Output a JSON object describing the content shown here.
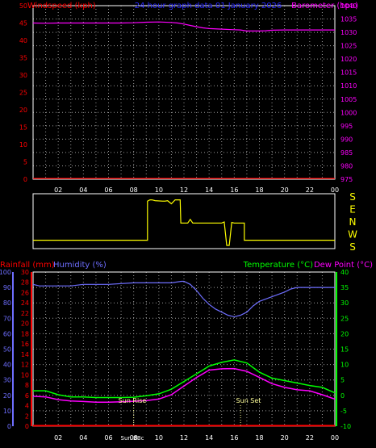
{
  "colors": {
    "background": "#000000",
    "frame": "#ffffff",
    "grid": "#9a9a9a",
    "windspeed": "#ff0000",
    "barometer": "#ff00ff",
    "title": "#2a2aff",
    "wind_dir": "#ffff00",
    "rainfall": "#ff0000",
    "humidity": "#6e6eff",
    "temperature": "#00ff00",
    "dewpoint": "#ff00ff",
    "sun": "#ffff99",
    "day_tick": "#ffffff"
  },
  "chart_data": [
    {
      "type": "line",
      "title": "24 hour graph data  01 January 2026",
      "x_ticks": [
        "02",
        "04",
        "06",
        "08",
        "10",
        "12",
        "14",
        "16",
        "18",
        "20",
        "22",
        "00"
      ],
      "y_left": {
        "label": "Windspeed (kph)",
        "range": [
          0,
          50
        ],
        "ticks": [
          "0",
          "5",
          "10",
          "15",
          "20",
          "25",
          "30",
          "35",
          "40",
          "45",
          "50"
        ]
      },
      "y_right": {
        "label": "Barometer (hpa)",
        "range": [
          975,
          1040
        ],
        "ticks": [
          "975",
          "980",
          "985",
          "990",
          "995",
          "1000",
          "1005",
          "1010",
          "1015",
          "1020",
          "1025",
          "1030",
          "1035",
          "1040"
        ]
      },
      "grid": true,
      "series": [
        {
          "name": "Windspeed (kph)",
          "axis": "left",
          "x": [
            0,
            24
          ],
          "y": [
            0.2,
            0.2
          ]
        },
        {
          "name": "Barometer (hpa)",
          "axis": "right",
          "x": [
            0,
            1,
            2,
            3,
            4,
            5,
            6,
            7,
            8,
            9,
            10,
            11,
            11.5,
            12,
            12.5,
            13,
            13.5,
            14,
            15,
            16,
            16.5,
            17,
            17.5,
            18,
            18.5,
            19,
            20,
            21,
            22,
            23,
            24
          ],
          "y": [
            1033.5,
            1033.4,
            1033.5,
            1033.5,
            1033.5,
            1033.5,
            1033.5,
            1033.5,
            1033.6,
            1033.8,
            1033.9,
            1033.7,
            1033.5,
            1033.1,
            1032.6,
            1032.1,
            1031.7,
            1031.4,
            1031.2,
            1031.0,
            1030.9,
            1030.5,
            1030.5,
            1030.5,
            1030.6,
            1030.8,
            1030.9,
            1030.9,
            1030.9,
            1030.9,
            1030.9
          ]
        }
      ]
    },
    {
      "type": "line",
      "y_labels": [
        "S",
        "E",
        "N",
        "W",
        "S"
      ],
      "series": [
        {
          "name": "Wind direction",
          "x": [
            0,
            9.1,
            9.1,
            9.3,
            9.45,
            9.7,
            10.3,
            10.5,
            10.7,
            11,
            11.3,
            11.7,
            11.75,
            12.3,
            12.5,
            12.7,
            13,
            15,
            15.2,
            15.4,
            15.6,
            15.8,
            16,
            16.5,
            16.8,
            16.8,
            18,
            24
          ],
          "y": [
            200,
            200,
            10,
            355,
            355,
            352,
            350,
            350,
            352,
            340,
            355,
            355,
            94,
            94,
            80,
            94,
            94,
            94,
            90,
            180,
            180,
            92,
            94,
            94,
            94,
            200,
            200,
            200
          ]
        }
      ]
    },
    {
      "type": "line",
      "x_ticks": [
        "02",
        "04",
        "06",
        "08",
        "10",
        "12",
        "14",
        "16",
        "18",
        "20",
        "22",
        "00"
      ],
      "y_left_outer": {
        "label": "Humidity (%)",
        "range": [
          0,
          100
        ],
        "ticks": [
          "0",
          "10",
          "20",
          "30",
          "40",
          "50",
          "60",
          "70",
          "80",
          "90",
          "100"
        ]
      },
      "y_left_inner": {
        "label": "Rainfall (mm)",
        "range": [
          0,
          30
        ],
        "ticks": [
          "0",
          "2",
          "4",
          "6",
          "8",
          "10",
          "12",
          "14",
          "16",
          "18",
          "20",
          "22",
          "24",
          "26",
          "28",
          "30"
        ]
      },
      "y_right": {
        "label_temp": "Temperature (°C)",
        "label_dew": "Dew Point (°C)",
        "range": [
          -10,
          40
        ],
        "ticks": [
          "-10",
          "-5",
          "0",
          "5",
          "10",
          "15",
          "20",
          "25",
          "30",
          "35",
          "40"
        ]
      },
      "annotations": {
        "sun_rise": "Sun Rise",
        "sun_set": "Sun Set",
        "sun_rise_hour": 8,
        "sun_set_hour": 16.5,
        "sun_bbc": "Sun BBc"
      },
      "grid": true,
      "series": [
        {
          "name": "Rainfall (mm)",
          "axis": "rain",
          "x": [
            0,
            24
          ],
          "y": [
            0.1,
            0.1
          ]
        },
        {
          "name": "Humidity (%)",
          "axis": "humidity",
          "x": [
            0,
            0.5,
            2,
            3,
            4,
            6,
            8,
            10,
            11,
            11.8,
            12,
            12.5,
            13,
            13.5,
            14,
            14.5,
            15,
            15.5,
            16,
            16.5,
            17,
            17.5,
            18,
            19,
            20,
            20.5,
            21,
            22,
            23,
            24
          ],
          "y": [
            92,
            91,
            91,
            91,
            92,
            92,
            93,
            93,
            93,
            94,
            94,
            92,
            88,
            83,
            79,
            76,
            74,
            72,
            71,
            72,
            74,
            78,
            81,
            84,
            87,
            89,
            90,
            90,
            90,
            90
          ]
        },
        {
          "name": "Temperature (°C)",
          "axis": "temp",
          "x": [
            0,
            1,
            2,
            3,
            4,
            5,
            6,
            7,
            8,
            9,
            10,
            11,
            12,
            13,
            14,
            15,
            16,
            17,
            18,
            19,
            20,
            21,
            22,
            23,
            24
          ],
          "y": [
            1.5,
            1.5,
            0.2,
            -0.5,
            -0.5,
            -0.7,
            -0.7,
            -0.7,
            -0.6,
            -0.1,
            0.5,
            2.0,
            4.5,
            7.0,
            9.5,
            10.7,
            11.5,
            10.5,
            7.5,
            5.6,
            4.8,
            4.0,
            3.2,
            2.6,
            0.8
          ]
        },
        {
          "name": "Dew Point (°C)",
          "axis": "temp",
          "x": [
            0,
            1,
            2,
            3,
            4,
            5,
            6,
            7,
            8,
            9,
            10,
            11,
            12,
            13,
            14,
            15,
            16,
            17,
            18,
            19,
            20,
            21,
            22,
            23,
            24
          ],
          "y": [
            -0.3,
            -0.5,
            -1.4,
            -1.8,
            -2.0,
            -2.2,
            -2.2,
            -2.1,
            -1.9,
            -1.7,
            -1.2,
            0.2,
            3.0,
            5.8,
            8.2,
            8.6,
            8.7,
            7.8,
            5.8,
            3.8,
            2.6,
            1.8,
            1.5,
            0.2,
            -1.2
          ]
        }
      ]
    }
  ]
}
